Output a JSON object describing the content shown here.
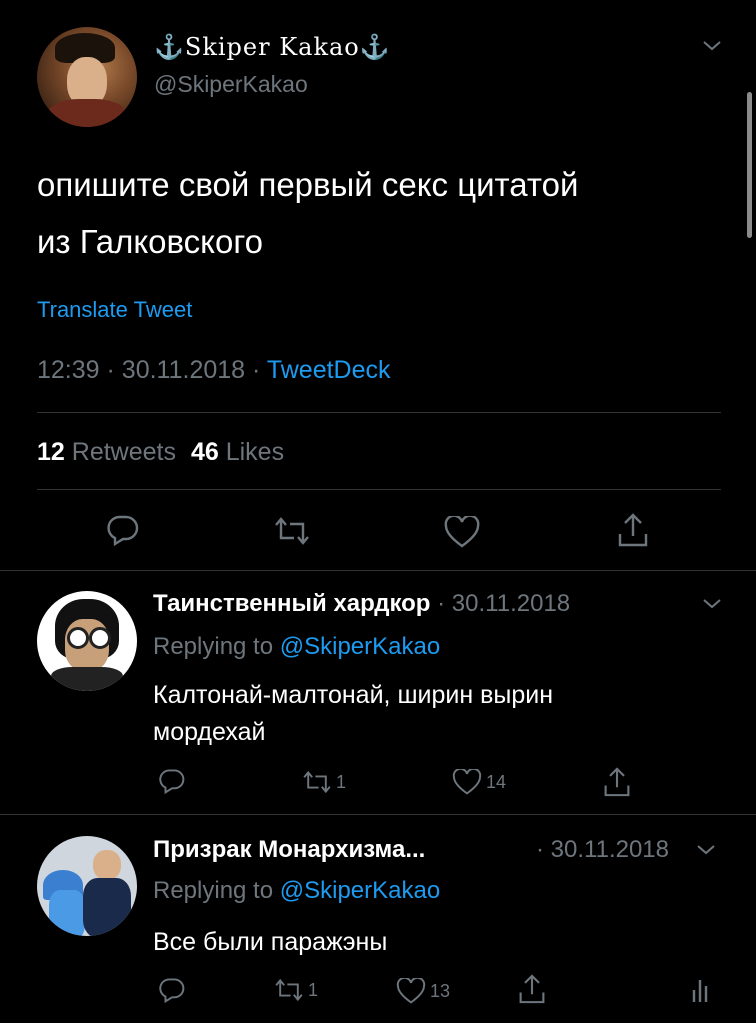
{
  "tweet": {
    "display_name": "⚓Skiper Kakao⚓",
    "handle": "@SkiperKakao",
    "text_line1": "опишите свой первый секс цитатой",
    "text_line2": "из Галковского",
    "translate_label": "Translate Tweet",
    "time": "12:39",
    "date": "30.11.2018",
    "source": "TweetDeck",
    "retweets_count": "12",
    "retweets_label": "Retweets",
    "likes_count": "46",
    "likes_label": "Likes"
  },
  "replies": [
    {
      "name": "Таинственный хардкор",
      "date": "· 30.11.2018",
      "replying_prefix": "Replying to",
      "replying_handle": "@SkiperKakao",
      "text_line1": "Калтонай-малтонай, ширин вырин",
      "text_line2": "мордехай",
      "retweet_count": "1",
      "like_count": "14"
    },
    {
      "name": "Призрак Монархизма...",
      "date": "· 30.11.2018",
      "replying_prefix": "Replying to",
      "replying_handle": "@SkiperKakao",
      "text_line1": "Все были паражэны",
      "retweet_count": "1",
      "like_count": "13"
    }
  ],
  "colors": {
    "background": "#000000",
    "accent": "#1d9bf0",
    "muted": "#6e767d",
    "divider": "#2f3336"
  },
  "icons": [
    "reply-icon",
    "retweet-icon",
    "like-icon",
    "share-icon",
    "chevron-down-icon",
    "analytics-icon"
  ]
}
